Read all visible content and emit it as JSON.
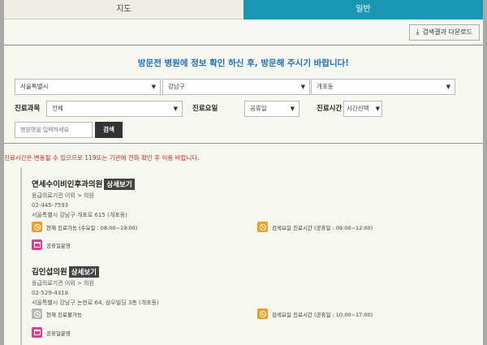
{
  "tabs": {
    "map": "지도",
    "general": "일반"
  },
  "download_label": "검색결과 다운로드",
  "notice": "방문전 병원에 정보 확인 하신 후, 방문해 주시기 바랍니다!",
  "filters": {
    "region1": "서울특별시",
    "region2": "강남구",
    "region3": "개포동",
    "dept_label": "진료과목",
    "dept_value": "전체",
    "day_label": "진료요일",
    "day_value": "공휴일",
    "time_label": "진료시간",
    "time_value": "시간선택",
    "name_placeholder": "병원명을 입력하세요",
    "search_label": "검색"
  },
  "warning": "진료시간은 변동될 수 있으므로 119또는 기관에 전화 확인 후 이용 바랍니다.",
  "detail_label": "상세보기",
  "hospitals": [
    {
      "name": "연세수이비인후과의원",
      "type": "응급의료기관 이외 > 의원",
      "phone": "02-445-7593",
      "address": "서울특별시 강남구 개포로 615 (개포동)",
      "status": "현재 진료가능 (수요일 : 08:00~19:00)",
      "holiday_hours": "검색요일 진료시간 (공휴일 : 09:00~12:00)",
      "holiday_note": "공휴일운영",
      "status_color": "#f0a020"
    },
    {
      "name": "김인섭의원",
      "type": "응급의료기관 이외 > 의원",
      "phone": "02-529-4318",
      "address": "서울특별시 강남구 논현로 64, 삼우빌딩 3층 (개포동)",
      "status": "현재 진료불가능",
      "holiday_hours": "검색요일 진료시간 (공휴일 : 10:00~17:00)",
      "holiday_note": "공휴일운영",
      "status_color": "#b8b8b8"
    }
  ]
}
